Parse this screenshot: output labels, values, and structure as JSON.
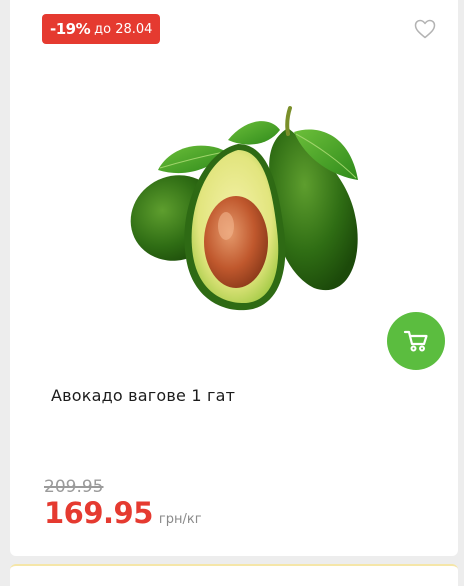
{
  "product": {
    "discount_percent": "-19%",
    "discount_until": "до 28.04",
    "title": "Авокадо вагове 1 гат",
    "old_price": "209.95",
    "price": "169.95",
    "unit": "грн/кг"
  },
  "icons": {
    "favorite": "heart-outline-icon",
    "cart": "shopping-cart-icon"
  },
  "colors": {
    "discount_red": "#e53a30",
    "cart_green": "#5bbd3f",
    "old_price_grey": "#9b9b9b"
  }
}
